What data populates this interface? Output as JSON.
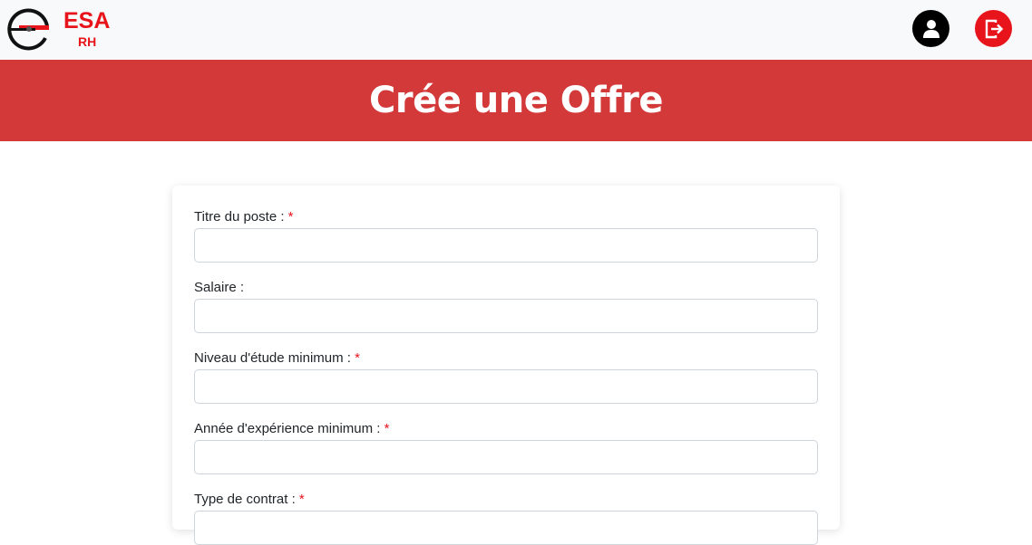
{
  "brand": {
    "name": "ESA",
    "sub": "RH"
  },
  "nav": {
    "profile_icon": "user-circle-icon",
    "logout_icon": "logout-icon"
  },
  "hero": {
    "title": "Crée une Offre"
  },
  "form": {
    "required_marker": "*",
    "fields": [
      {
        "label": "Titre du poste :",
        "required": true,
        "value": "",
        "placeholder": ""
      },
      {
        "label": "Salaire :",
        "required": false,
        "value": "",
        "placeholder": ""
      },
      {
        "label": "Niveau d'étude minimum :",
        "required": true,
        "value": "",
        "placeholder": ""
      },
      {
        "label": "Année d'expérience minimum :",
        "required": true,
        "value": "",
        "placeholder": ""
      },
      {
        "label": "Type de contrat :",
        "required": true,
        "value": "",
        "placeholder": ""
      }
    ]
  },
  "colors": {
    "brand_red": "#e8141c",
    "hero_red": "#d4393a",
    "navbar_bg": "#f8f9fa"
  }
}
